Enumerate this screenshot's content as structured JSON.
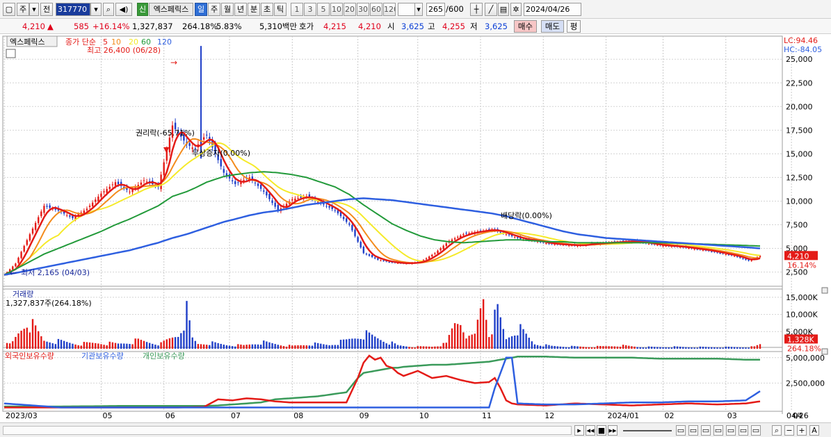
{
  "toolbar": {
    "menu_label": "주",
    "prev_label": "전",
    "code": "317770",
    "shin_label": "신",
    "stock_name": "엑스페릭스",
    "periods": [
      "일",
      "주",
      "월",
      "년",
      "분",
      "초",
      "틱"
    ],
    "active_period": "일",
    "intervals": [
      "1",
      "3",
      "5",
      "10",
      "20",
      "30",
      "60",
      "120"
    ],
    "count_value": "265",
    "count_total": "/600",
    "date_value": "2024/04/26"
  },
  "quote": {
    "price": "4,210",
    "change_arrow": "▲",
    "change": "585",
    "change_pct": "+16.14%",
    "volume": "1,327,837",
    "volume_ratio": "264.18%",
    "turnover": "5.83%",
    "amount": "5,310백만",
    "hoga_label": "호가",
    "ask": "4,215",
    "bid": "4,210",
    "open_label": "시",
    "open": "3,625",
    "high_label": "고",
    "high": "4,255",
    "low_label": "저",
    "low": "3,625",
    "buy_label": "매수",
    "sell_label": "매도",
    "avg_label": "평"
  },
  "bottom": {
    "date_label": "04/26"
  },
  "colors": {
    "ma5": "#e41b17",
    "ma10": "#f38b1c",
    "ma20": "#f5ea2a",
    "ma60": "#229a3a",
    "ma120": "#2e5fe0",
    "up": "#e41b17",
    "down": "#1f3fc8",
    "foreign": "#e41b17",
    "inst": "#2e5fe0",
    "indiv": "#3a9a5a"
  },
  "chart_data": [
    {
      "type": "line",
      "title": "엑스페릭스",
      "legend": [
        "종가 단순",
        "5",
        "10",
        "20",
        "60",
        "120"
      ],
      "yticks": [
        "25,000",
        "22,500",
        "20,000",
        "17,500",
        "15,000",
        "12,500",
        "10,000",
        "7,500",
        "5,000",
        "2,500"
      ],
      "yvalues": [
        25000,
        22500,
        20000,
        17500,
        15000,
        12500,
        10000,
        7500,
        5000,
        2500
      ],
      "ylim": [
        1000,
        27000
      ],
      "lc": "LC:94.46",
      "hc": "HC:-84.05",
      "last_price": "4,210",
      "last_pct": "16.14%",
      "annotations": {
        "high": "최고 26,400 (06/28)",
        "low": "최저 2,165 (04/03)",
        "rights": "권리락(-65.71%)",
        "bonus": "무상증자(0.00%)",
        "dividend": "배당락(0.00%)"
      },
      "x": [
        0,
        4,
        9,
        14,
        19,
        24,
        29,
        34,
        39,
        44,
        49,
        54,
        59,
        64,
        67,
        69,
        71,
        74,
        77,
        81,
        86,
        91,
        96,
        101,
        106,
        111,
        116,
        121,
        126,
        131,
        136,
        141,
        146,
        151,
        156,
        161,
        166,
        171,
        176,
        181,
        186,
        191,
        196,
        201,
        206,
        211,
        216,
        221,
        226,
        231,
        236,
        241,
        246,
        251,
        256,
        261,
        265
      ],
      "close": [
        2200,
        3400,
        6500,
        9500,
        9000,
        8200,
        9200,
        10800,
        12000,
        11000,
        12200,
        11500,
        18000,
        16000,
        15500,
        16500,
        17000,
        15000,
        13000,
        11800,
        12500,
        11000,
        9000,
        10200,
        10500,
        9800,
        9000,
        7500,
        4500,
        3800,
        3500,
        3400,
        3600,
        4500,
        5800,
        6500,
        6800,
        7000,
        6500,
        6000,
        5800,
        5500,
        5400,
        5300,
        5500,
        5600,
        5700,
        5800,
        5500,
        5300,
        5200,
        5000,
        4800,
        4500,
        4200,
        3700,
        4210
      ],
      "ma60_vals": [
        2200,
        2800,
        3600,
        4400,
        5000,
        5600,
        6200,
        6800,
        7500,
        8100,
        8800,
        9500,
        10500,
        11000,
        11400,
        11700,
        12000,
        12300,
        12600,
        12800,
        13000,
        13100,
        13000,
        12800,
        12500,
        12000,
        11500,
        10700,
        9600,
        8600,
        7600,
        6900,
        6300,
        5900,
        5700,
        5600,
        5700,
        5800,
        5900,
        5900,
        5800,
        5700,
        5700,
        5600,
        5600,
        5600,
        5600,
        5600,
        5600,
        5600,
        5550,
        5500,
        5450,
        5400,
        5350,
        5300,
        5250
      ],
      "ma120_vals": [
        2200,
        2400,
        2700,
        3000,
        3300,
        3600,
        3900,
        4200,
        4500,
        4800,
        5200,
        5600,
        6100,
        6500,
        6800,
        7000,
        7200,
        7500,
        7800,
        8100,
        8500,
        8800,
        9000,
        9300,
        9600,
        9800,
        10000,
        10200,
        10300,
        10200,
        10100,
        9900,
        9700,
        9500,
        9300,
        9100,
        8900,
        8700,
        8400,
        8000,
        7600,
        7200,
        6800,
        6500,
        6300,
        6100,
        6000,
        5900,
        5800,
        5700,
        5600,
        5500,
        5400,
        5300,
        5200,
        5100,
        5000
      ]
    },
    {
      "type": "bar",
      "title": "거래량",
      "current": "1,327,837주(264.18%)",
      "yticks": [
        "15,000K",
        "10,000K",
        "5,000K"
      ],
      "yvalues": [
        15000,
        10000,
        5000
      ],
      "ylim": [
        0,
        17000
      ],
      "last_value": "1,328K",
      "last_pct": "264.18%",
      "x": [
        3,
        8,
        14,
        20,
        26,
        33,
        40,
        47,
        55,
        61,
        64,
        66,
        68,
        72,
        78,
        84,
        90,
        95,
        101,
        108,
        114,
        120,
        126,
        132,
        138,
        144,
        150,
        155,
        158,
        160,
        163,
        165,
        168,
        170,
        173,
        176,
        180,
        186,
        192,
        198,
        204,
        210,
        216,
        222,
        228,
        234,
        240,
        246,
        252,
        258,
        263,
        265
      ],
      "values": [
        2000,
        9000,
        2500,
        2200,
        1500,
        1800,
        1500,
        2500,
        1500,
        4500,
        11000,
        3000,
        1500,
        1800,
        1200,
        1000,
        2000,
        1500,
        800,
        1500,
        1200,
        2500,
        4500,
        3000,
        1000,
        600,
        700,
        1500,
        8000,
        9000,
        3000,
        4000,
        17000,
        5000,
        11000,
        3000,
        6500,
        1500,
        800,
        700,
        600,
        700,
        1000,
        600,
        500,
        600,
        500,
        500,
        500,
        500,
        600,
        1328
      ]
    },
    {
      "type": "line",
      "title": "보유수량",
      "series_names": [
        "외국인보유수량",
        "기관보유수량",
        "개인보유수량"
      ],
      "yticks": [
        "5,000,000",
        "2,500,000"
      ],
      "yvalues": [
        5000000,
        2500000
      ],
      "ylim": [
        0,
        5600000
      ],
      "x": [
        0,
        20,
        40,
        60,
        70,
        75,
        80,
        85,
        90,
        95,
        100,
        110,
        120,
        124,
        126,
        128,
        130,
        132,
        134,
        136,
        138,
        140,
        145,
        150,
        155,
        160,
        165,
        170,
        172,
        174,
        176,
        178,
        180,
        190,
        200,
        210,
        220,
        230,
        240,
        250,
        260,
        265
      ],
      "foreign": [
        100000,
        100000,
        100000,
        100000,
        150000,
        900000,
        800000,
        1000000,
        900000,
        700000,
        600000,
        600000,
        600000,
        3000000,
        4500000,
        5200000,
        4800000,
        5000000,
        4200000,
        4000000,
        3500000,
        3200000,
        3700000,
        3000000,
        3200000,
        2800000,
        2500000,
        2600000,
        3000000,
        2000000,
        800000,
        500000,
        400000,
        300000,
        500000,
        400000,
        300000,
        400000,
        500000,
        400000,
        500000,
        700000
      ],
      "institution": [
        500000,
        100000,
        100000,
        100000,
        100000,
        100000,
        100000,
        100000,
        100000,
        100000,
        100000,
        100000,
        100000,
        100000,
        100000,
        100000,
        100000,
        100000,
        100000,
        100000,
        100000,
        100000,
        100000,
        100000,
        100000,
        100000,
        100000,
        100000,
        2000000,
        3500000,
        5000000,
        5000000,
        500000,
        400000,
        400000,
        500000,
        600000,
        600000,
        700000,
        700000,
        800000,
        1700000
      ],
      "individual": [
        200000,
        200000,
        250000,
        250000,
        250000,
        300000,
        400000,
        500000,
        600000,
        900000,
        1000000,
        1200000,
        1600000,
        3000000,
        3500000,
        3600000,
        3700000,
        3800000,
        3900000,
        4000000,
        4000000,
        4100000,
        4200000,
        4300000,
        4300000,
        4400000,
        4500000,
        4600000,
        4700000,
        4800000,
        4900000,
        5000000,
        5100000,
        5100000,
        5000000,
        5000000,
        5000000,
        4900000,
        4900000,
        4900000,
        4800000,
        4800000
      ]
    }
  ],
  "xaxis": {
    "labels": [
      "2023/03",
      "05",
      "06",
      "07",
      "08",
      "09",
      "10",
      "11",
      "12",
      "2024/01",
      "02",
      "03",
      "04"
    ],
    "positions": [
      0,
      34,
      56,
      79,
      101,
      124,
      145,
      167,
      189,
      211,
      231,
      253,
      276
    ]
  }
}
